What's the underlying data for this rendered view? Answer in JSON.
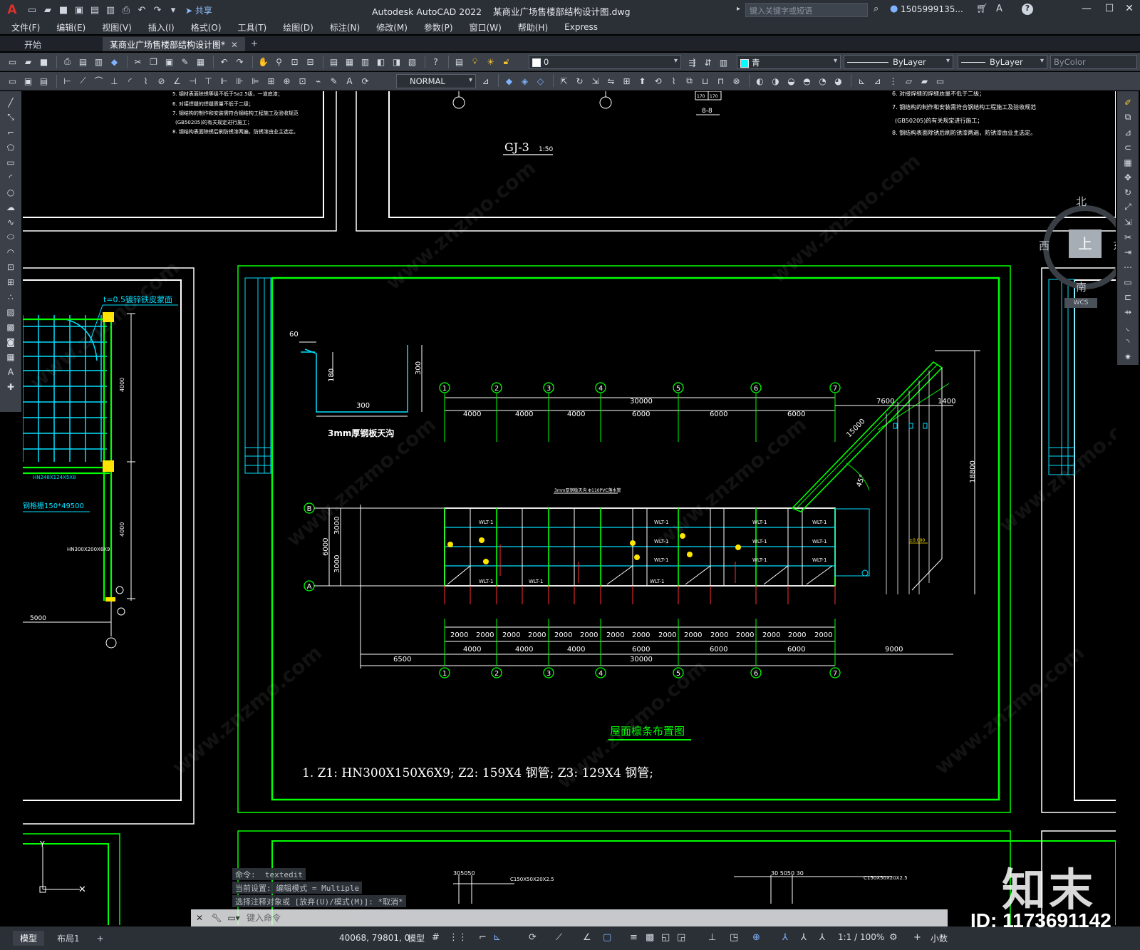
{
  "app": {
    "logo": "A",
    "title": "Autodesk AutoCAD 2022    某商业广场售楼部结构设计图.dwg",
    "share_label": "共享",
    "search_placeholder": "键入关键字或短语",
    "user": "1505999135...",
    "help": "?"
  },
  "menu": [
    "文件(F)",
    "编辑(E)",
    "视图(V)",
    "插入(I)",
    "格式(O)",
    "工具(T)",
    "绘图(D)",
    "标注(N)",
    "修改(M)",
    "参数(P)",
    "窗口(W)",
    "帮助(H)",
    "Express"
  ],
  "tabs": [
    {
      "label": "开始"
    },
    {
      "label": "某商业广场售楼部结构设计图*"
    }
  ],
  "toolbar": {
    "layer_value": "0",
    "color_value": "青",
    "color_swatch": "#00ffff",
    "linetype_value": "ByLayer",
    "lineweight_value": "ByLayer",
    "plotstyle_value": "ByColor",
    "dimstyle_value": "NORMAL"
  },
  "compass": {
    "north": "北",
    "south": "南",
    "east": "东",
    "west": "西",
    "top": "上",
    "wcs": "WCS"
  },
  "drawing": {
    "title": "屋面檩条布置图",
    "note": "1.  Z1:      HN300X150X6X9; Z2: 159X4 钢管; Z3: 129X4 钢管;",
    "gj3_label": "GJ-3",
    "gj3_scale": "1:50",
    "gutter_label": "3mm厚钢板天沟",
    "gutter_dims": [
      "60",
      "180",
      "300",
      "300"
    ],
    "axis_numbers": [
      "1",
      "2",
      "3",
      "4",
      "5",
      "6",
      "7"
    ],
    "axis_letters": [
      "B",
      "A"
    ],
    "top_total": "30000",
    "top_spans": [
      "4000",
      "4000",
      "4000",
      "6000",
      "6000",
      "6000"
    ],
    "bottom_spans_fine": [
      "2000",
      "2000",
      "2000",
      "2000",
      "2000",
      "2000",
      "2000",
      "2000",
      "2000",
      "2000",
      "2000",
      "2000",
      "2000",
      "2000",
      "2000"
    ],
    "bottom_spans": [
      "4000",
      "4000",
      "4000",
      "6000",
      "6000",
      "6000",
      "9000"
    ],
    "bottom_total": "30000",
    "left_extra": "6500",
    "vertical_dims": [
      "3000",
      "3000",
      "6000"
    ],
    "ramp_dims": [
      "7600",
      "1400",
      "15000",
      "18800",
      "45°"
    ],
    "left_notes": [
      "t=0.5镀锌铁皮蒙面",
      "HN248X124X5X8",
      "钢格栅150*49500",
      "HN300X200X6X9",
      "5000",
      "4000",
      "4000"
    ],
    "top_left_notes": [
      "5. 钢材表面除锈等级不低于Sa2.5级，一道底漆；",
      "6. 对接焊缝的焊缝质量不低于二级；",
      "7. 钢结构的制作和安装需符合钢结构工程施工及验收规范",
      "(GB50205)的有关规定进行施工；",
      "8. 钢结构表面除锈后刷防锈漆两遍，防锈漆由业主选定。"
    ],
    "top_right_notes": [
      "6. 对接焊缝的焊缝质量不低于二级；",
      "7. 钢结构的制作和安装需符合钢结构工程施工及验收规范",
      "(GB50205)的有关规定进行施工；",
      "8. 钢结构表面除锈后刷防锈漆两遍，防锈漆由业主选定。"
    ],
    "purlin_label": "WLT-1",
    "bottom_labels": [
      "C150X50X20X2.5",
      "C150X50X20X2.5"
    ],
    "section_label": "8-8"
  },
  "command": {
    "history": [
      "命令:  textedit",
      "当前设置: 编辑模式 = Multiple",
      "选择注释对象或 [放弃(U)/模式(M)]: *取消*"
    ],
    "placeholder": "键入命令"
  },
  "status": {
    "layout_tabs": [
      "模型",
      "布局1"
    ],
    "coords": "40068, 79801, 0",
    "model_label": "模型",
    "scale": "1:1 / 100%",
    "units": "小数"
  },
  "watermark": {
    "brand": "知末",
    "id": "ID: 1173691142"
  }
}
